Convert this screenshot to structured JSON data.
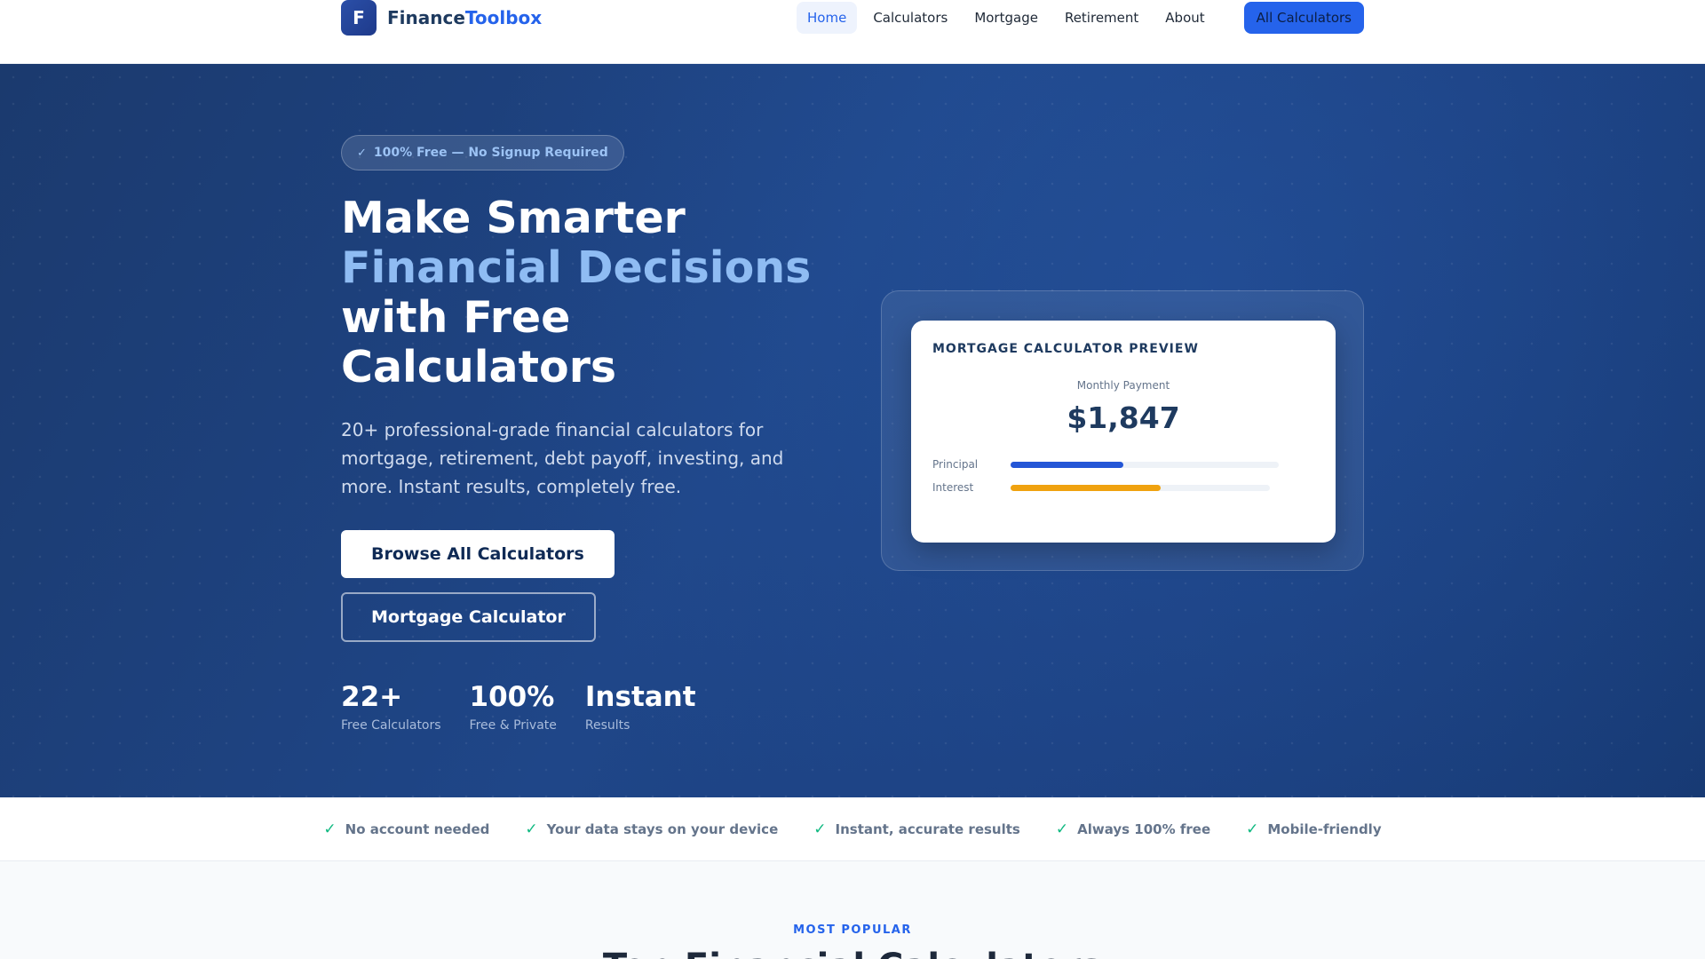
{
  "brand": {
    "logo_letter": "F",
    "name_main": "Finance",
    "name_accent": "Toolbox"
  },
  "nav": {
    "links": [
      "Home",
      "Calculators",
      "Mortgage",
      "Retirement",
      "About"
    ],
    "active": "Home",
    "cta": "All Calculators"
  },
  "hero": {
    "pill": "100% Free — No Signup Required",
    "headline": [
      "Make Smarter",
      "Financial Decisions",
      "with Free",
      "Calculators"
    ],
    "subtext": "20+ professional-grade financial calculators for mortgage, retirement, debt payoff, investing, and more. Instant results, completely free.",
    "primary_button": "Browse All Calculators",
    "secondary_button": "Mortgage Calculator",
    "stats": [
      {
        "value": "22+",
        "label": "Free Calculators"
      },
      {
        "value": "100%",
        "label": "Free & Private"
      },
      {
        "value": "Instant",
        "label": "Results"
      }
    ]
  },
  "preview": {
    "title": "MORTGAGE CALCULATOR PREVIEW",
    "sub": "Monthly Payment",
    "amount": "$1,847",
    "bars": [
      {
        "label": "Principal",
        "fraction": 0.42,
        "color": "#2456d6"
      },
      {
        "label": "Interest",
        "fraction": 0.58,
        "color": "#f0a20f"
      }
    ]
  },
  "trust": [
    "No account needed",
    "Your data stays on your device",
    "Instant, accurate results",
    "Always 100% free",
    "Mobile-friendly"
  ],
  "popular": {
    "eyebrow": "MOST POPULAR",
    "title": "Top Financial Calculators"
  },
  "colors": {
    "accent": "#2563eb",
    "hero_dark": "#1b3a6e",
    "success": "#10b981"
  }
}
